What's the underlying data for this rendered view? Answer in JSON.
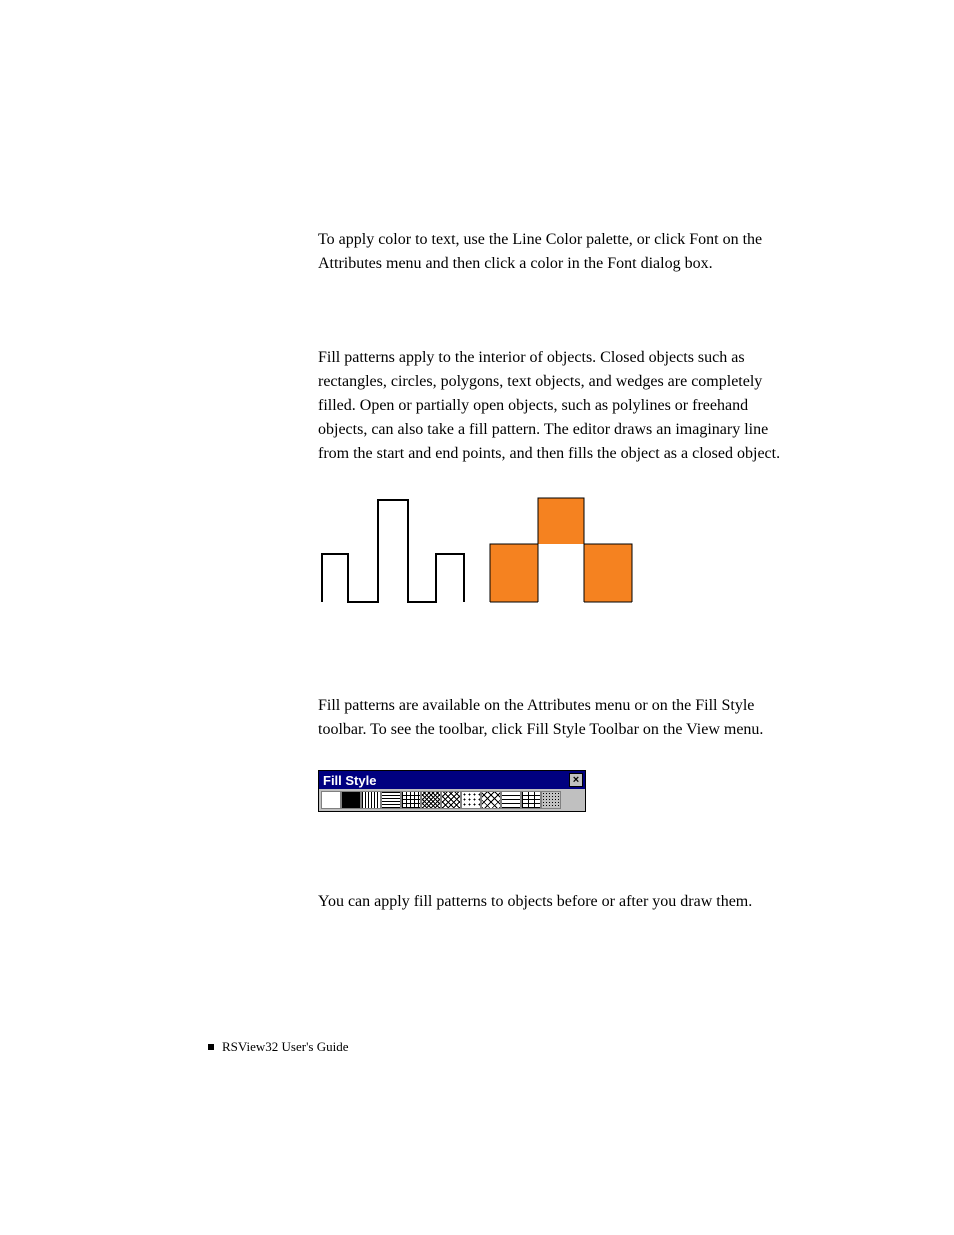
{
  "body": {
    "para1": "To apply color to text, use the Line Color palette, or click Font on the Attributes menu and then click a color in the Font dialog box.",
    "para2": "Fill patterns apply to the interior of objects. Closed objects such as rectangles, circles, polygons, text objects, and wedges are completely filled. Open or partially open objects, such as polylines or freehand objects, can also take a fill pattern. The editor draws an imaginary line from the start and end points, and then fills the object as a closed object.",
    "para3": "Fill patterns are available on the Attributes menu or on the Fill Style toolbar. To see the toolbar, click Fill Style Toolbar on the View menu.",
    "para4": "You can apply fill patterns to objects before or after you draw them."
  },
  "toolbar": {
    "title": "Fill Style",
    "close_label": "×"
  },
  "colors": {
    "accent": "#f58220",
    "titlebar": "#000080"
  },
  "footer": {
    "text": "RSView32  User's Guide"
  }
}
